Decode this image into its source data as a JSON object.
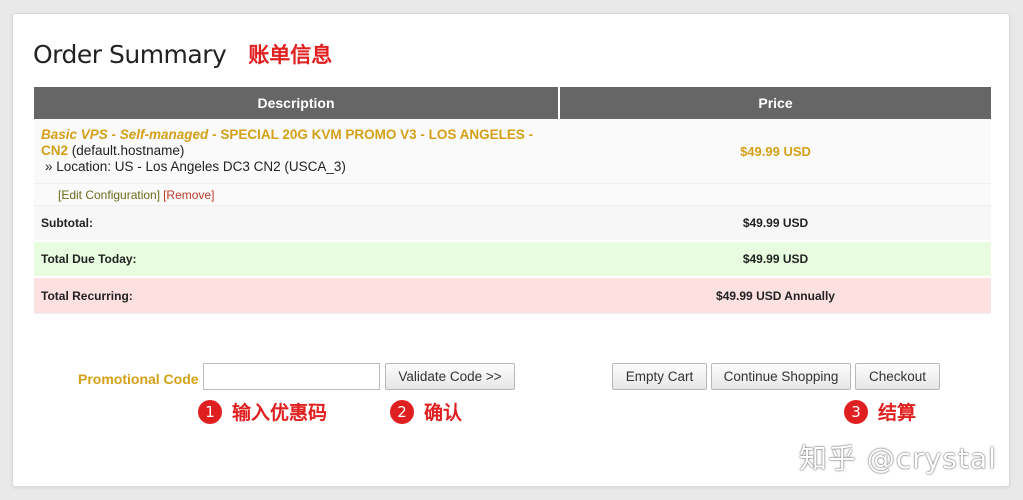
{
  "header": {
    "title": "Order Summary",
    "annotation": "账单信息"
  },
  "table": {
    "headers": {
      "description": "Description",
      "price": "Price"
    },
    "item": {
      "product_name": "Basic VPS - Self-managed",
      "separator": " - ",
      "product_detail": "SPECIAL 20G KVM PROMO V3 - LOS ANGELES - CN2",
      "hostname": " (default.hostname)",
      "location": "» Location: US - Los Angeles DC3 CN2 (USCA_3)",
      "price": "$49.99 USD",
      "edit_label": "[Edit Configuration]",
      "remove_label": "[Remove]"
    },
    "summary": [
      {
        "label": "Subtotal:",
        "value": "$49.99 USD"
      },
      {
        "label": "Total Due Today:",
        "value": "$49.99 USD"
      },
      {
        "label": "Total Recurring:",
        "value": "$49.99 USD Annually"
      }
    ]
  },
  "promo": {
    "label": "Promotional Code",
    "input_value": "",
    "validate_label": "Validate Code >>"
  },
  "actions": {
    "empty_cart": "Empty Cart",
    "continue_shopping": "Continue Shopping",
    "checkout": "Checkout"
  },
  "steps": [
    {
      "num": "1",
      "text": "输入优惠码"
    },
    {
      "num": "2",
      "text": "确认"
    },
    {
      "num": "3",
      "text": "结算"
    }
  ],
  "watermark": "知乎 @crystal",
  "colors": {
    "accent_gold": "#d4a017",
    "annotation_red": "#e02020",
    "header_gray": "#666666",
    "due_today_bg": "#e8fde0",
    "recurring_bg": "#fde0e0"
  }
}
